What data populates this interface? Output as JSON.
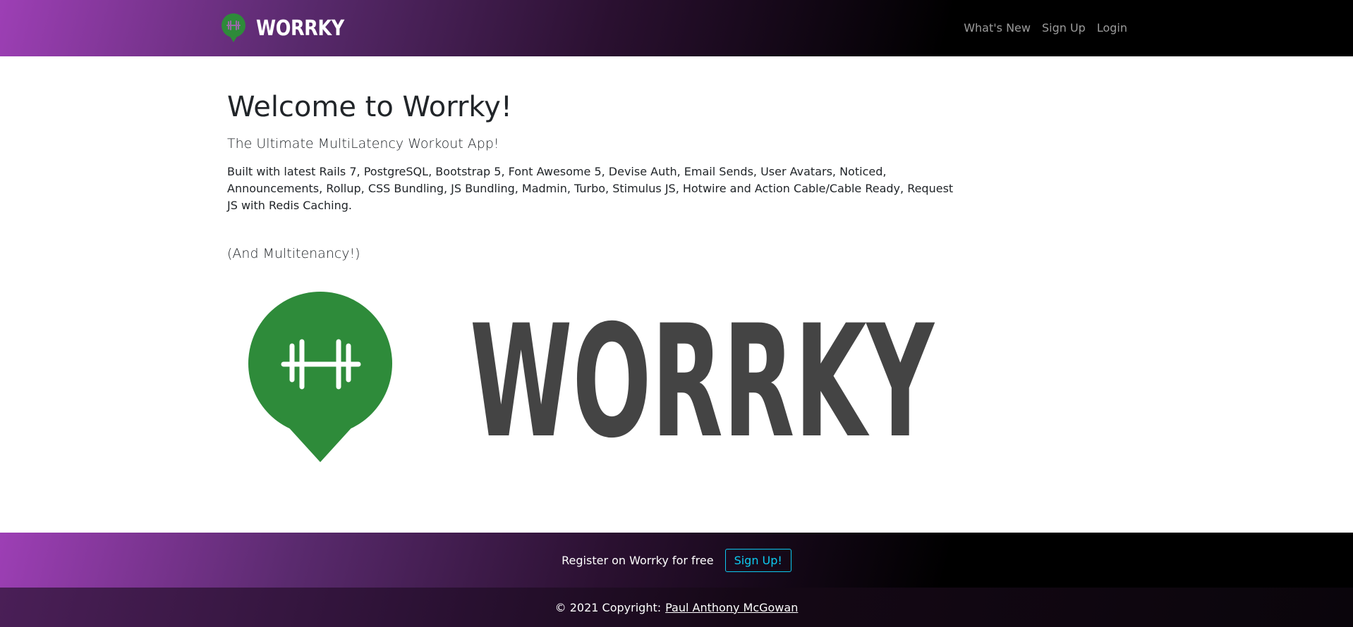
{
  "navbar": {
    "brand_text": "WORRKY",
    "links": [
      {
        "label": "What's New"
      },
      {
        "label": "Sign Up"
      },
      {
        "label": "Login"
      }
    ]
  },
  "main": {
    "title": "Welcome to Worrky!",
    "subtitle": "The Ultimate MultiLatency Workout App!",
    "description": "Built with latest Rails 7, PostgreSQL, Bootstrap 5, Font Awesome 5, Devise Auth, Email Sends, User Avatars, Noticed, Announcements, Rollup, CSS Bundling, JS Bundling, Madmin, Turbo, Stimulus JS, Hotwire and Action Cable/Cable Ready, Request JS with Redis Caching.",
    "note": "(And Multitenancy!)",
    "hero_logo_text": "WORRKY"
  },
  "footer": {
    "cta_text": "Register on Worrky for free",
    "cta_button": "Sign Up!",
    "copyright_prefix": "© 2021 Copyright:",
    "copyright_link": "Paul Anthony McGowan"
  },
  "colors": {
    "brand_green": "#2e8b3a",
    "logo_text_gray": "#444444",
    "cta_accent": "#0dcaf0",
    "gradient_start": "#9d3fb5"
  },
  "icons": {
    "brand": "dumbbell-pin-icon",
    "hero": "dumbbell-pin-icon"
  }
}
